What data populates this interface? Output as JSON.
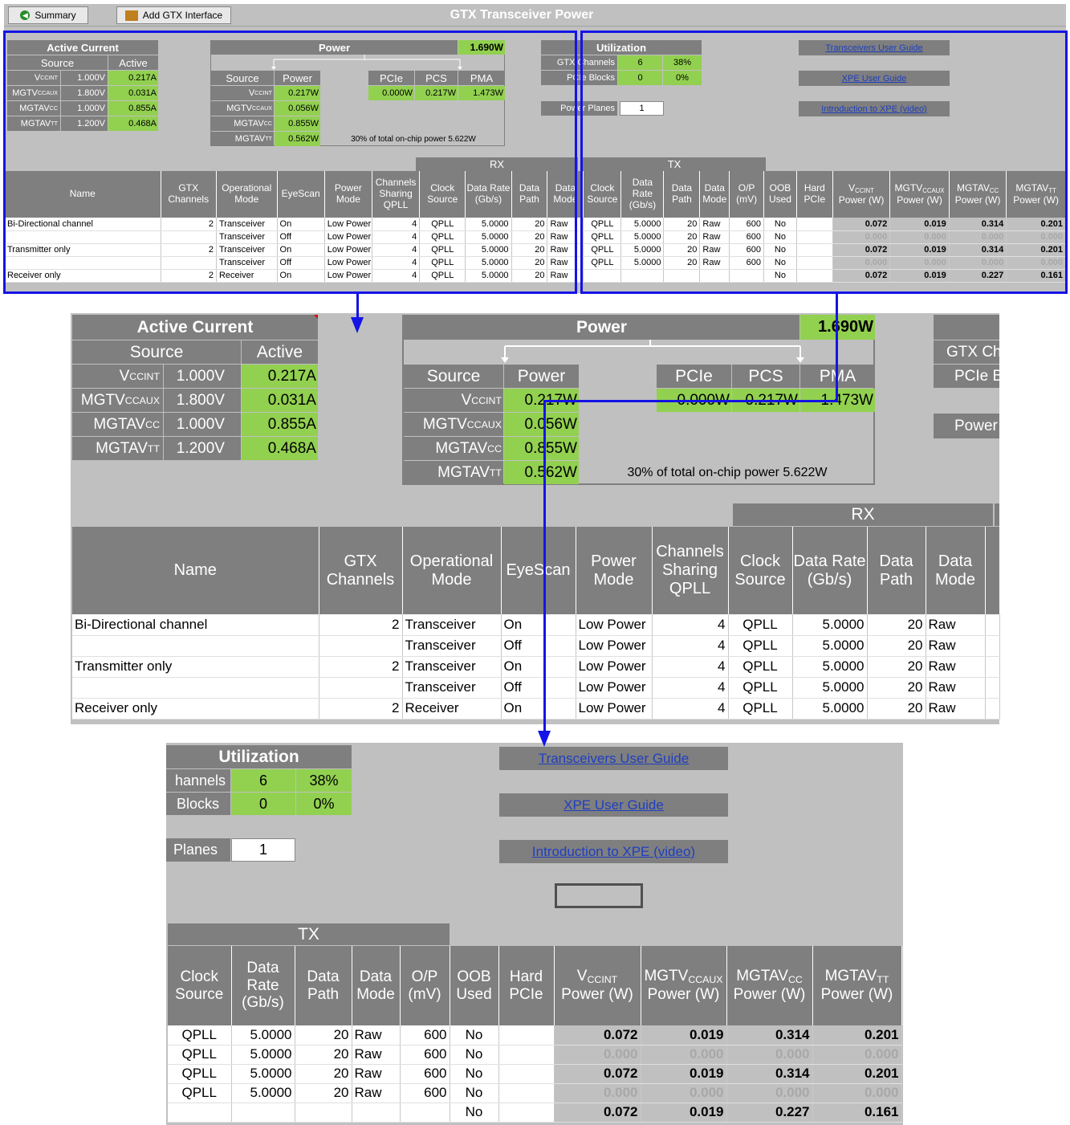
{
  "toolbar": {
    "summary_label": "Summary",
    "add_label": "Add GTX Interface",
    "title": "GTX Transceiver Power"
  },
  "active_current": {
    "title": "Active Current",
    "col_source": "Source",
    "col_active": "Active",
    "rows": [
      {
        "name": "V",
        "sub": "CCINT",
        "voltage": "1.000V",
        "active": "0.217A"
      },
      {
        "name": "MGTV",
        "sub": "CCAUX",
        "voltage": "1.800V",
        "active": "0.031A"
      },
      {
        "name": "MGTAV",
        "sub": "CC",
        "voltage": "1.000V",
        "active": "0.855A"
      },
      {
        "name": "MGTAV",
        "sub": "TT",
        "voltage": "1.200V",
        "active": "0.468A"
      }
    ]
  },
  "power": {
    "title": "Power",
    "total": "1.690W",
    "col_source": "Source",
    "col_power": "Power",
    "rows": [
      {
        "name": "V",
        "sub": "CCINT",
        "value": "0.217W"
      },
      {
        "name": "MGTV",
        "sub": "CCAUX",
        "value": "0.056W"
      },
      {
        "name": "MGTAV",
        "sub": "CC",
        "value": "0.855W"
      },
      {
        "name": "MGTAV",
        "sub": "TT",
        "value": "0.562W"
      }
    ],
    "breakdown_labels": [
      "PCIe",
      "PCS",
      "PMA"
    ],
    "breakdown_values": [
      "0.000W",
      "0.217W",
      "1.473W"
    ],
    "note": "30% of total on-chip power 5.622W"
  },
  "utilization": {
    "title": "Utilization",
    "rows": [
      {
        "label": "GTX Channels",
        "value": "6",
        "pct": "38%"
      },
      {
        "label": "PCIe Blocks",
        "value": "0",
        "pct": "0%"
      }
    ],
    "planes_label": "Power Planes",
    "planes_value": "1",
    "zoom_row1": "hannels",
    "zoom_row2": "Blocks",
    "zoom_planes": "Planes"
  },
  "links": [
    "Transceivers User Guide",
    "XPE User Guide",
    "Introduction to XPE (video)"
  ],
  "table": {
    "rx_label": "RX",
    "tx_label": "TX",
    "headers": [
      "Name",
      "GTX Channels",
      "Operational Mode",
      "EyeScan",
      "Power Mode",
      "Channels Sharing QPLL",
      "Clock Source",
      "Data Rate (Gb/s)",
      "Data Path",
      "Data Mode",
      "Clock Source",
      "Data Rate (Gb/s)",
      "Data Path",
      "Data Mode",
      "O/P (mV)",
      "OOB Used",
      "Hard PCIe"
    ],
    "power_headers": [
      {
        "name": "V",
        "sub": "CCINT"
      },
      {
        "name": "MGTV",
        "sub": "CCAUX"
      },
      {
        "name": "MGTAV",
        "sub": "CC"
      },
      {
        "name": "MGTAV",
        "sub": "TT"
      }
    ],
    "power_header_suffix": "Power (W)",
    "rows": [
      [
        "Bi-Directional channel",
        "2",
        "Transceiver",
        "On",
        "Low Power",
        "4",
        "QPLL",
        "5.0000",
        "20",
        "Raw",
        "QPLL",
        "5.0000",
        "20",
        "Raw",
        "600",
        "No",
        "",
        "0.072",
        "0.019",
        "0.314",
        "0.201"
      ],
      [
        "",
        "",
        "Transceiver",
        "Off",
        "Low Power",
        "4",
        "QPLL",
        "5.0000",
        "20",
        "Raw",
        "QPLL",
        "5.0000",
        "20",
        "Raw",
        "600",
        "No",
        "",
        "0.000",
        "0.000",
        "0.000",
        "0.000"
      ],
      [
        "Transmitter only",
        "2",
        "Transceiver",
        "On",
        "Low Power",
        "4",
        "QPLL",
        "5.0000",
        "20",
        "Raw",
        "QPLL",
        "5.0000",
        "20",
        "Raw",
        "600",
        "No",
        "",
        "0.072",
        "0.019",
        "0.314",
        "0.201"
      ],
      [
        "",
        "",
        "Transceiver",
        "Off",
        "Low Power",
        "4",
        "QPLL",
        "5.0000",
        "20",
        "Raw",
        "QPLL",
        "5.0000",
        "20",
        "Raw",
        "600",
        "No",
        "",
        "0.000",
        "0.000",
        "0.000",
        "0.000"
      ],
      [
        "Receiver only",
        "2",
        "Receiver",
        "On",
        "Low Power",
        "4",
        "QPLL",
        "5.0000",
        "20",
        "Raw",
        "",
        "",
        "",
        "",
        "",
        "No",
        "",
        "0.072",
        "0.019",
        "0.227",
        "0.161"
      ]
    ]
  },
  "colors": {
    "accent_green": "#92d050",
    "header_gray": "#7f7f7f",
    "bg_gray": "#c0c0c0",
    "highlight_blue": "#1414e6"
  }
}
